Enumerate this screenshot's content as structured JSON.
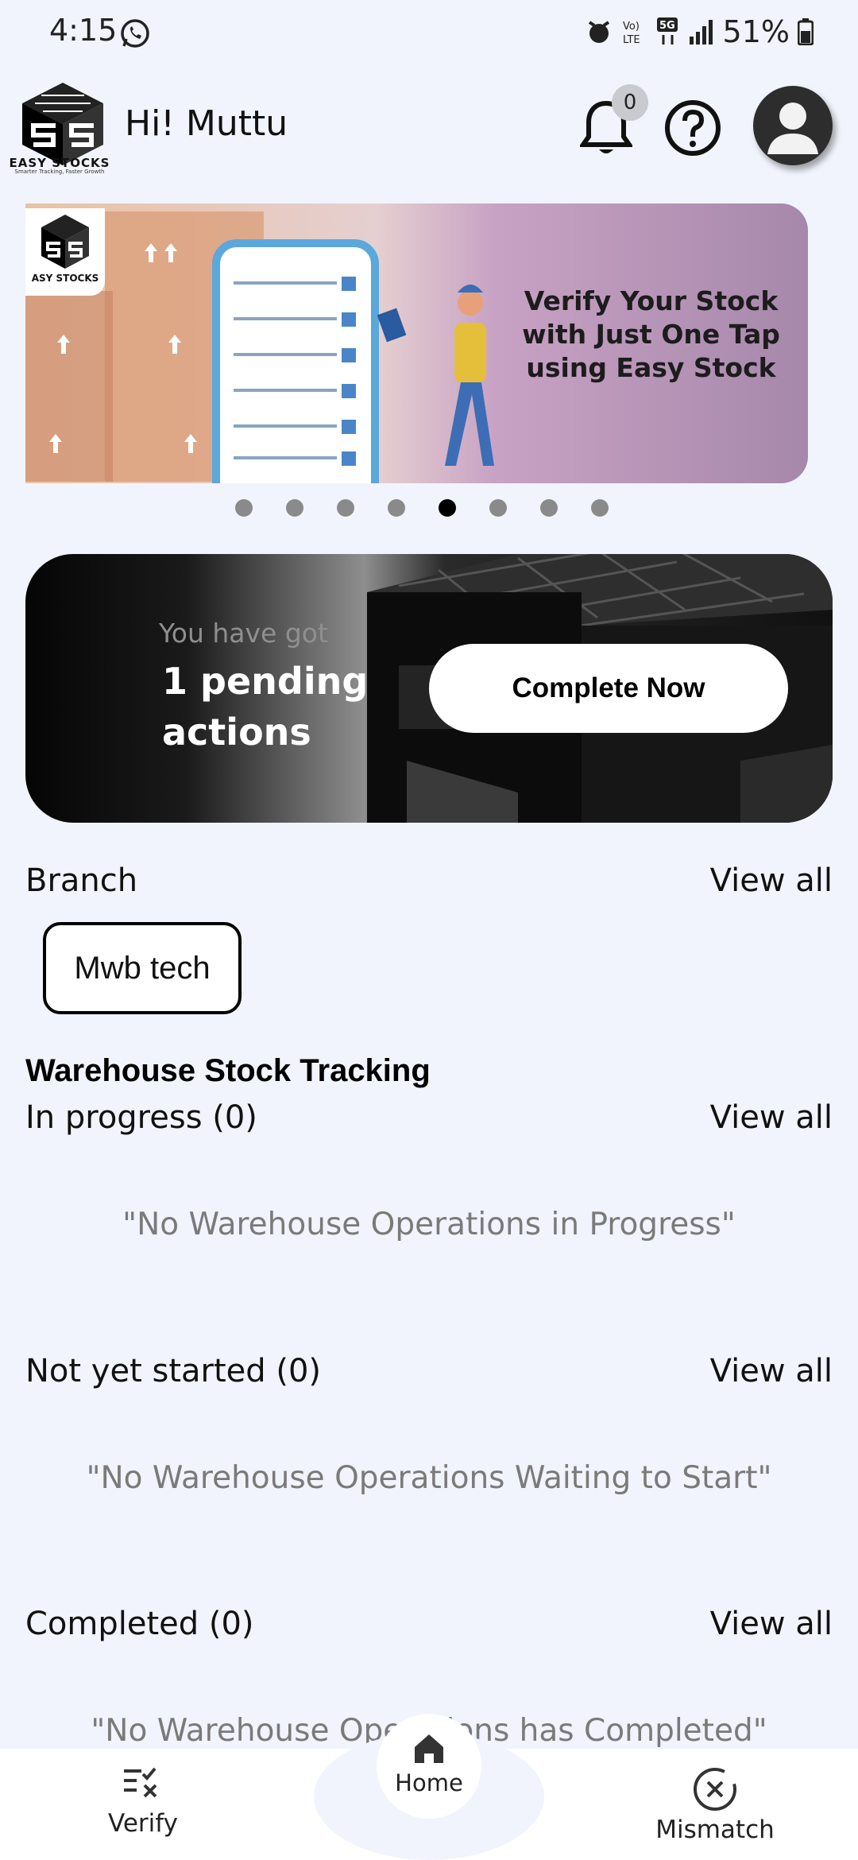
{
  "status_bar": {
    "time": "4:15",
    "battery": "51%"
  },
  "header": {
    "greeting": "Hi! Muttu",
    "notification_count": "0",
    "logo_name": "EASY STOCKS",
    "logo_tagline": "Smarter Tracking, Faster Growth"
  },
  "carousel": {
    "banner_text": "Verify Your Stock with Just One Tap using Easy Stock",
    "slide_count": 8,
    "active_slide": 5
  },
  "pending": {
    "subtitle": "You have got",
    "headline": "1 pending actions",
    "button_label": "Complete Now"
  },
  "branch": {
    "label": "Branch",
    "view_all": "View all",
    "chip": "Mwb tech"
  },
  "warehouse": {
    "title": "Warehouse Stock Tracking",
    "in_progress": {
      "label": "In progress (0)",
      "view_all": "View all",
      "empty": "\"No Warehouse Operations in Progress\""
    },
    "not_started": {
      "label": "Not yet started (0)",
      "view_all": "View all",
      "empty": "\"No Warehouse Operations Waiting to Start\""
    },
    "completed": {
      "label": "Completed (0)",
      "view_all": "View all",
      "empty": "\"No Warehouse Operations has Completed\""
    }
  },
  "bottom_nav": {
    "verify": "Verify",
    "home": "Home",
    "mismatch": "Mismatch"
  }
}
